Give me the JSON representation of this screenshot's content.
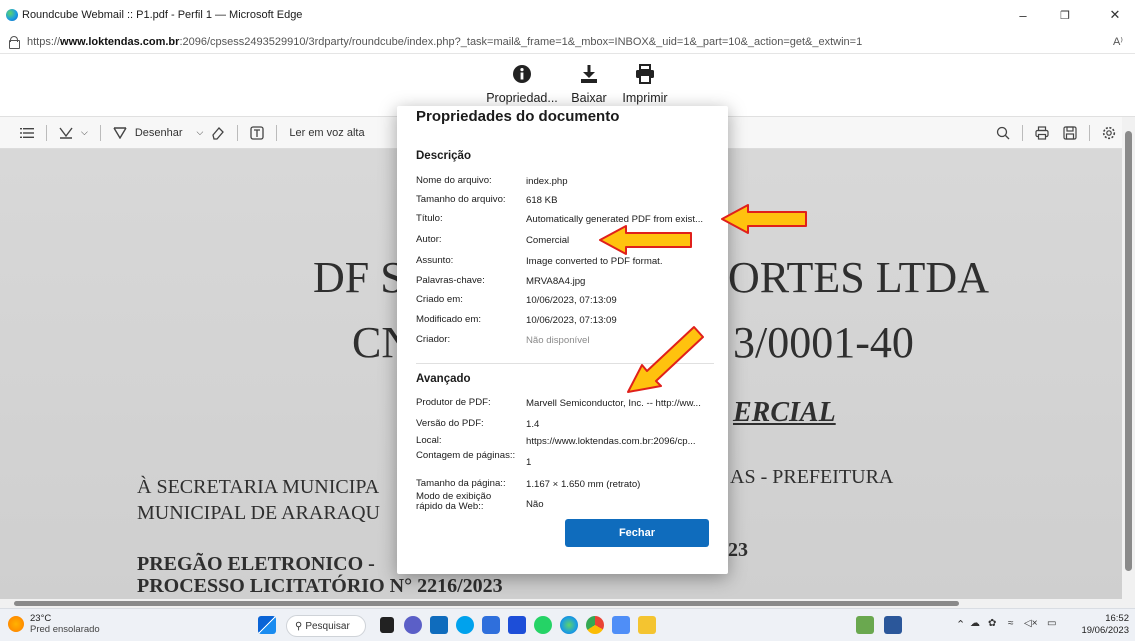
{
  "window": {
    "title": "Roundcube Webmail :: P1.pdf - Perfil 1 — Microsoft Edge",
    "minimize": "–",
    "restore": "❐",
    "close": "✕"
  },
  "address": {
    "prefix": "https://",
    "host": "www.loktendas.com.br",
    "rest": ":2096/cpsess2493529910/3rdparty/roundcube/index.php?_task=mail&_frame=1&_mbox=INBOX&_uid=1&_part=10&_action=get&_extwin=1",
    "read_aloud": "A⁾"
  },
  "rc_toolbar": {
    "properties": "Propriedad...",
    "download": "Baixar",
    "print": "Imprimir"
  },
  "pdf_toolbar": {
    "draw": "Desenhar",
    "read_aloud": "Ler em voz alta"
  },
  "document": {
    "line1_left": "DF S",
    "line1_right": "ORTES LTDA",
    "line2_left": "CN",
    "line2_right": "3/0001-40",
    "line3_right": "ERCIAL",
    "line4_left": "À SECRETARIA MUNICIPA",
    "line4_right": "AS - PREFEITURA",
    "line5_left": "MUNICIPAL DE ARARAQU",
    "line6_left": "PREGÃO ELETRONICO -",
    "line6_right": "23",
    "line7_left": "PROCESSO LICITATÓRIO N° 2216/2023"
  },
  "dialog": {
    "title": "Propriedades do documento",
    "section_description": "Descrição",
    "section_advanced": "Avançado",
    "description_rows": [
      {
        "key": "Nome do arquivo:",
        "value": "index.php"
      },
      {
        "key": "Tamanho do arquivo:",
        "value": "618 KB"
      },
      {
        "key": "Título:",
        "value": "Automatically generated PDF from exist..."
      },
      {
        "key": "Autor:",
        "value": "Comercial"
      },
      {
        "key": "Assunto:",
        "value": "Image converted to PDF format."
      },
      {
        "key": "Palavras-chave:",
        "value": "MRVA8A4.jpg"
      },
      {
        "key": "Criado em:",
        "value": "10/06/2023, 07:13:09"
      },
      {
        "key": "Modificado em:",
        "value": "10/06/2023, 07:13:09"
      },
      {
        "key": "Criador:",
        "value": "Não disponível"
      }
    ],
    "advanced_rows": [
      {
        "key": "Produtor de PDF:",
        "value": "Marvell Semiconductor, Inc. -- http://ww..."
      },
      {
        "key": "Versão do PDF:",
        "value": "1.4"
      },
      {
        "key": "Local:",
        "value": "https://www.loktendas.com.br:2096/cp..."
      },
      {
        "key": "Contagem de páginas::",
        "value": "1"
      },
      {
        "key": "Tamanho da página::",
        "value": "1.167 × 1.650 mm (retrato)"
      },
      {
        "key": "Modo de exibição rápido da Web::",
        "value": "Não"
      }
    ],
    "close_label": "Fechar"
  },
  "taskbar": {
    "temperature": "23°C",
    "condition": "Pred ensolarado",
    "search_label": "Pesquisar",
    "time": "16:52",
    "date": "19/06/2023"
  },
  "colors": {
    "accent": "#0f6cbd",
    "arrow_fill": "#ffc20e",
    "arrow_stroke": "#e0201b"
  }
}
